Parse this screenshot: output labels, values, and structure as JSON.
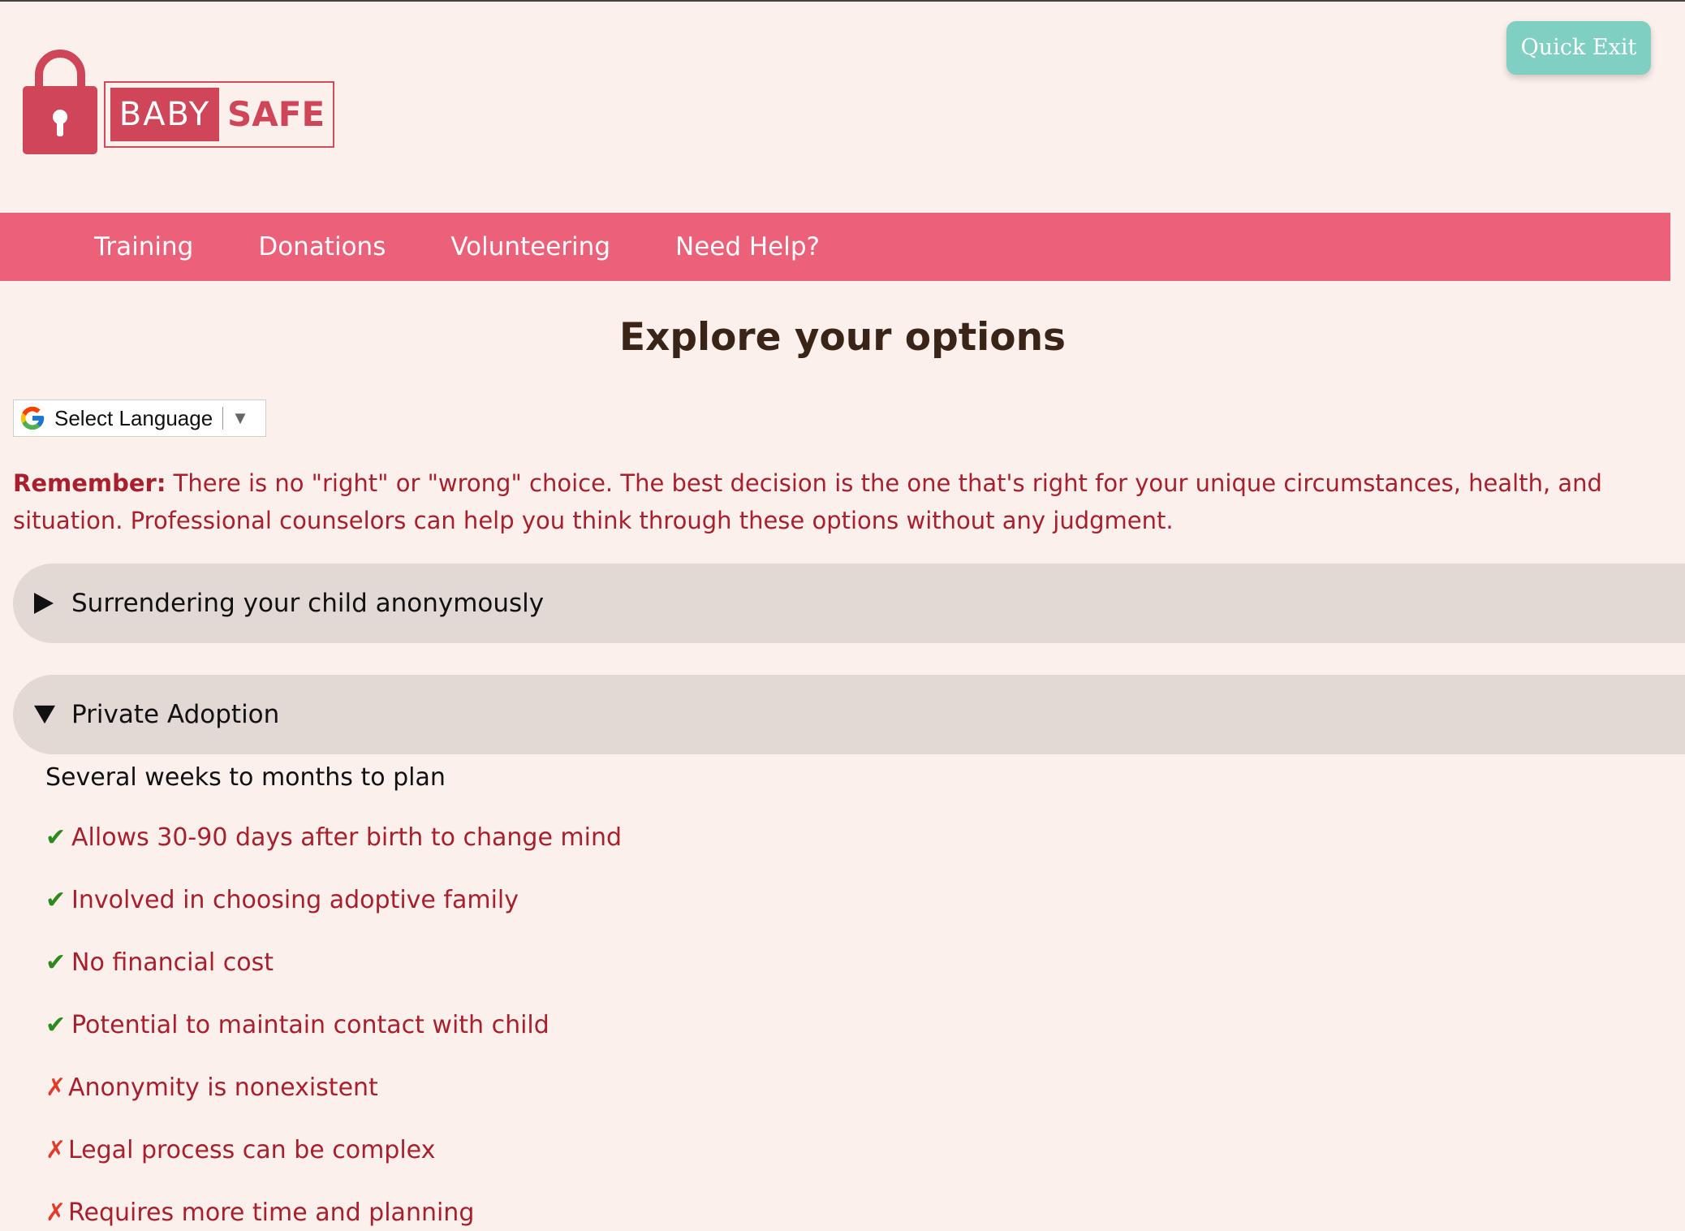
{
  "logo": {
    "word1": "BABY",
    "word2": "SAFE",
    "brand_color": "#cf4658"
  },
  "quick_exit_label": "Quick Exit",
  "nav": {
    "items": [
      {
        "label": "Training"
      },
      {
        "label": "Donations"
      },
      {
        "label": "Volunteering"
      },
      {
        "label": "Need Help?"
      }
    ],
    "color": "#ec617a"
  },
  "page_title": "Explore your options",
  "language_select": {
    "selected": "Select Language"
  },
  "remember": {
    "lead": "Remember:",
    "text": " There is no \"right\" or \"wrong\" choice. The best decision is the one that's right for your unique circumstances, health, and situation. Professional counselors can help you think through these options without any judgment."
  },
  "accordions": [
    {
      "label": "Surrendering your child anonymously",
      "expanded": false
    },
    {
      "label": "Private Adoption",
      "expanded": true
    }
  ],
  "private_adoption": {
    "timeline": "Several weeks to months to plan",
    "pros": [
      "Allows 30-90 days after birth to change mind",
      "Involved in choosing adoptive family",
      "No financial cost",
      "Potential to maintain contact with child"
    ],
    "cons": [
      "Anonymity is nonexistent",
      "Legal process can be complex",
      "Requires more time and planning"
    ],
    "pro_mark": "✔",
    "con_mark": "✗"
  }
}
